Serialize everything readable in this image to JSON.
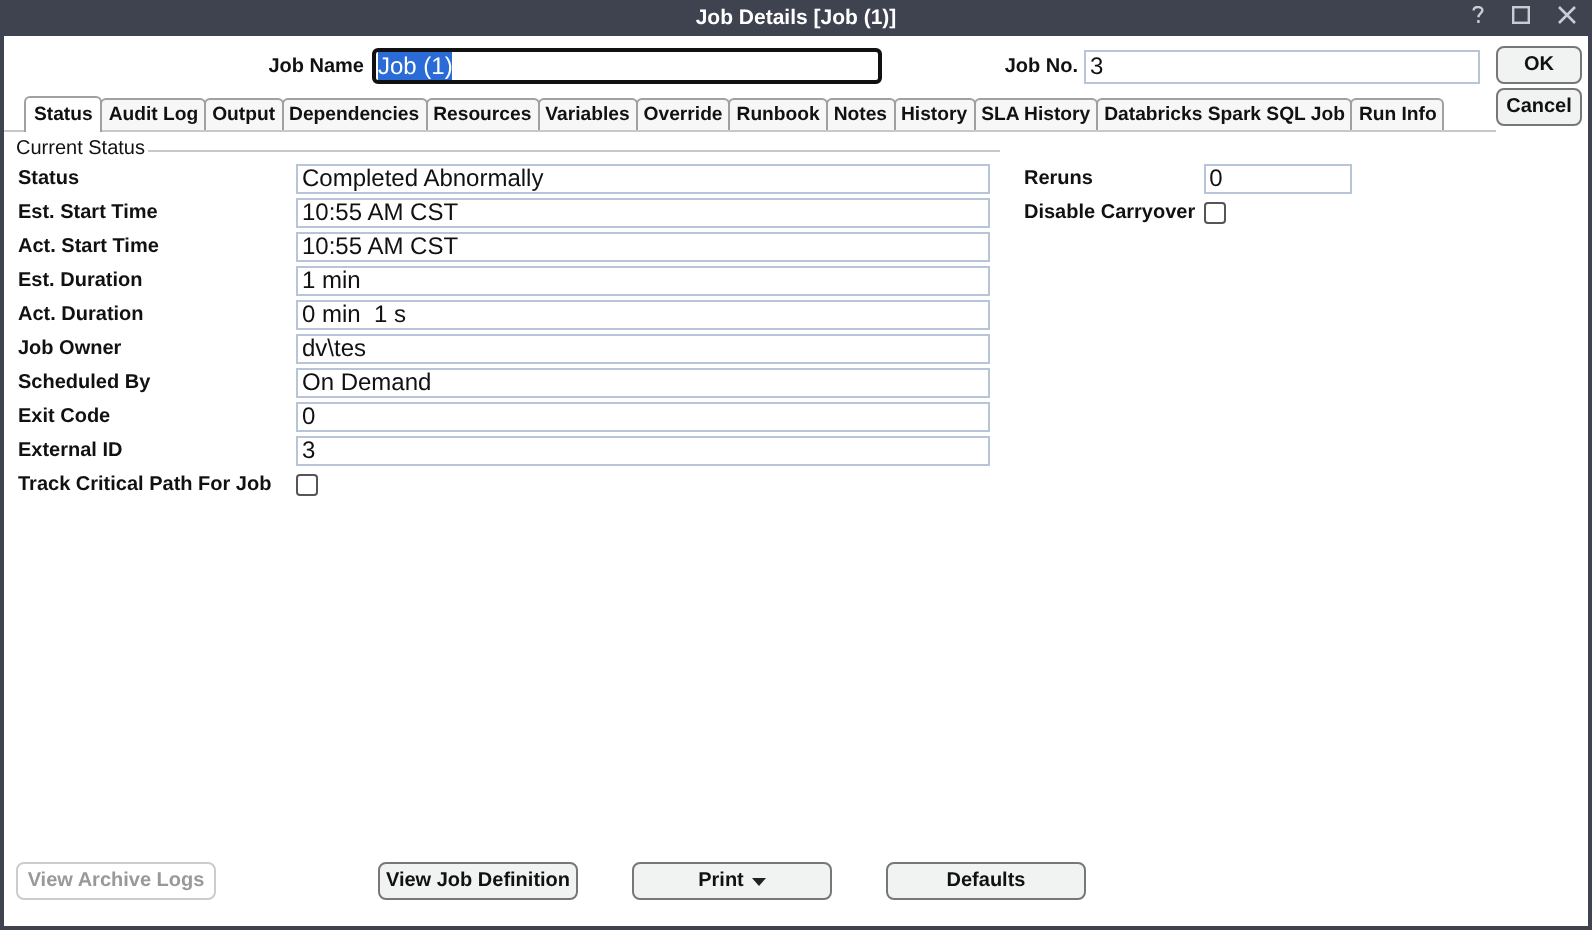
{
  "window": {
    "title": "Job Details [Job (1)]"
  },
  "job_name": {
    "label": "Job Name",
    "value": "Job (1)",
    "text_selected": true
  },
  "job_no": {
    "label": "Job No.",
    "value": "3"
  },
  "side_buttons": [
    {
      "label": "OK"
    },
    {
      "label": "Cancel"
    }
  ],
  "tabs": [
    {
      "label": "Status",
      "selected": true
    },
    {
      "label": "Audit Log",
      "selected": false
    },
    {
      "label": "Output",
      "selected": false
    },
    {
      "label": "Dependencies",
      "selected": false
    },
    {
      "label": "Resources",
      "selected": false
    },
    {
      "label": "Variables",
      "selected": false
    },
    {
      "label": "Override",
      "selected": false
    },
    {
      "label": "Runbook",
      "selected": false
    },
    {
      "label": "Notes",
      "selected": false
    },
    {
      "label": "History",
      "selected": false
    },
    {
      "label": "SLA History",
      "selected": false
    },
    {
      "label": "Databricks Spark SQL Job",
      "selected": false
    },
    {
      "label": "Run Info",
      "selected": false
    }
  ],
  "group_title": "Current Status",
  "fields": [
    {
      "kind": "text",
      "label": "Status",
      "value": "Completed Abnormally"
    },
    {
      "kind": "text",
      "label": "Est. Start Time",
      "value": "10:55 AM CST"
    },
    {
      "kind": "text",
      "label": "Act. Start Time",
      "value": "10:55 AM CST"
    },
    {
      "kind": "text",
      "label": "Est. Duration",
      "value": "1 min"
    },
    {
      "kind": "text",
      "label": "Act. Duration",
      "value": "0 min  1 s"
    },
    {
      "kind": "text",
      "label": "Job Owner",
      "value": "dv\\tes"
    },
    {
      "kind": "text",
      "label": "Scheduled By",
      "value": "On Demand"
    },
    {
      "kind": "text",
      "label": "Exit Code",
      "value": "0"
    },
    {
      "kind": "text",
      "label": "External ID",
      "value": "3"
    },
    {
      "kind": "checkbox",
      "label": "Track Critical Path For Job",
      "checked": false
    }
  ],
  "right_fields": [
    {
      "kind": "text",
      "label": "Reruns",
      "value": "0"
    },
    {
      "kind": "checkbox",
      "label": "Disable Carryover",
      "checked": false
    }
  ],
  "bottom_buttons": [
    {
      "label": "View Archive Logs",
      "disabled": true,
      "dropdown": false
    },
    {
      "label": "View Job Definition",
      "disabled": false,
      "dropdown": false
    },
    {
      "label": "Print",
      "disabled": false,
      "dropdown": true
    },
    {
      "label": "Defaults",
      "disabled": false,
      "dropdown": false
    }
  ]
}
